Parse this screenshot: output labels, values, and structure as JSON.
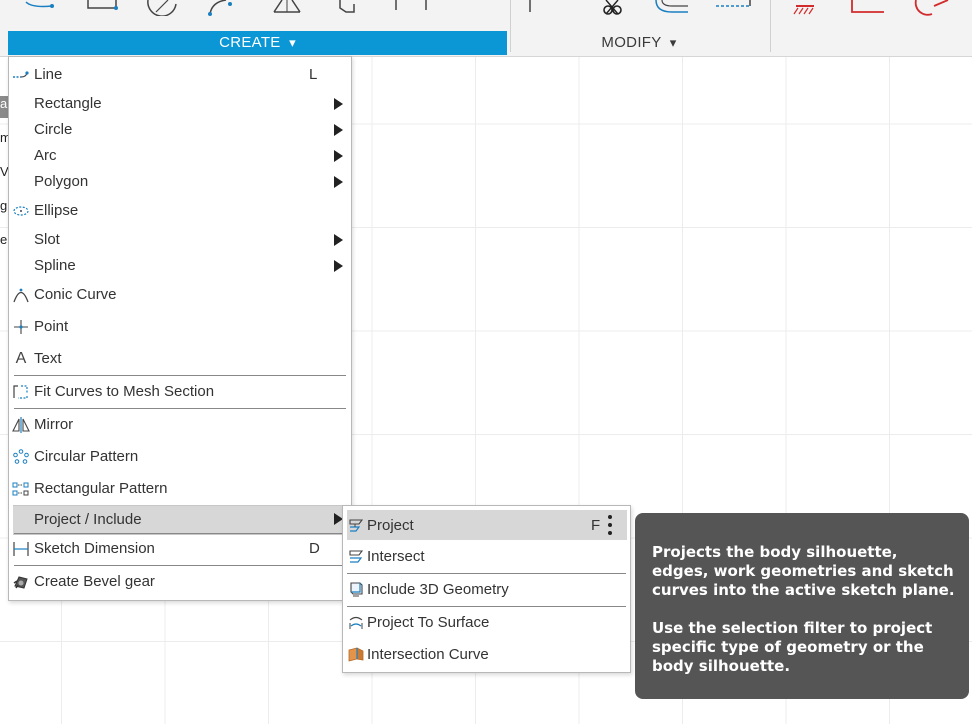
{
  "toolbar": {
    "create_label": "CREATE",
    "modify_label": "MODIFY",
    "dropdown_caret": "▾"
  },
  "left_strip": [
    "a",
    "m",
    "V",
    "gi",
    "e"
  ],
  "create_menu": {
    "items": [
      {
        "label": "Line",
        "shortcut": "L",
        "icon": "line-icon"
      },
      {
        "label": "Rectangle",
        "icon": "none"
      },
      {
        "label": "Circle",
        "icon": "none"
      },
      {
        "label": "Arc",
        "icon": "none"
      },
      {
        "label": "Polygon",
        "icon": "none"
      },
      {
        "label": "Ellipse",
        "icon": "ellipse-icon"
      },
      {
        "label": "Slot",
        "icon": "none"
      },
      {
        "label": "Spline",
        "icon": "none"
      },
      {
        "label": "Conic Curve",
        "icon": "conic-curve-icon"
      },
      {
        "label": "Point",
        "icon": "point-icon"
      },
      {
        "label": "Text",
        "icon": "text-icon",
        "glyph": "A"
      },
      {
        "label": "Fit Curves to Mesh Section",
        "icon": "fit-curves-icon"
      },
      {
        "label": "Mirror",
        "icon": "mirror-icon"
      },
      {
        "label": "Circular Pattern",
        "icon": "circular-pattern-icon"
      },
      {
        "label": "Rectangular Pattern",
        "icon": "rectangular-pattern-icon"
      },
      {
        "label": "Project / Include",
        "icon": "none"
      },
      {
        "label": "Sketch Dimension",
        "shortcut": "D",
        "icon": "sketch-dimension-icon"
      },
      {
        "label": "Create Bevel gear",
        "icon": "bevel-gear-icon"
      }
    ]
  },
  "project_submenu": {
    "items": [
      {
        "label": "Project",
        "shortcut": "F",
        "icon": "project-icon"
      },
      {
        "label": "Intersect",
        "icon": "intersect-icon"
      },
      {
        "label": "Include 3D Geometry",
        "icon": "include-3d-geometry-icon"
      },
      {
        "label": "Project To Surface",
        "icon": "project-to-surface-icon"
      },
      {
        "label": "Intersection Curve",
        "icon": "intersection-curve-icon"
      }
    ]
  },
  "tooltip": {
    "paragraph_1": "Projects the body silhouette, edges, work geometries and sketch curves into the active sketch plane.",
    "paragraph_2": "Use the selection filter to project specific type of geometry or the body silhouette."
  },
  "colors": {
    "create_accent": "#0b96d6",
    "highlight": "#d7d7d7",
    "tooltip_bg": "#555555",
    "icon_blue": "#1a7fc1",
    "icon_red": "#d22b2b"
  }
}
